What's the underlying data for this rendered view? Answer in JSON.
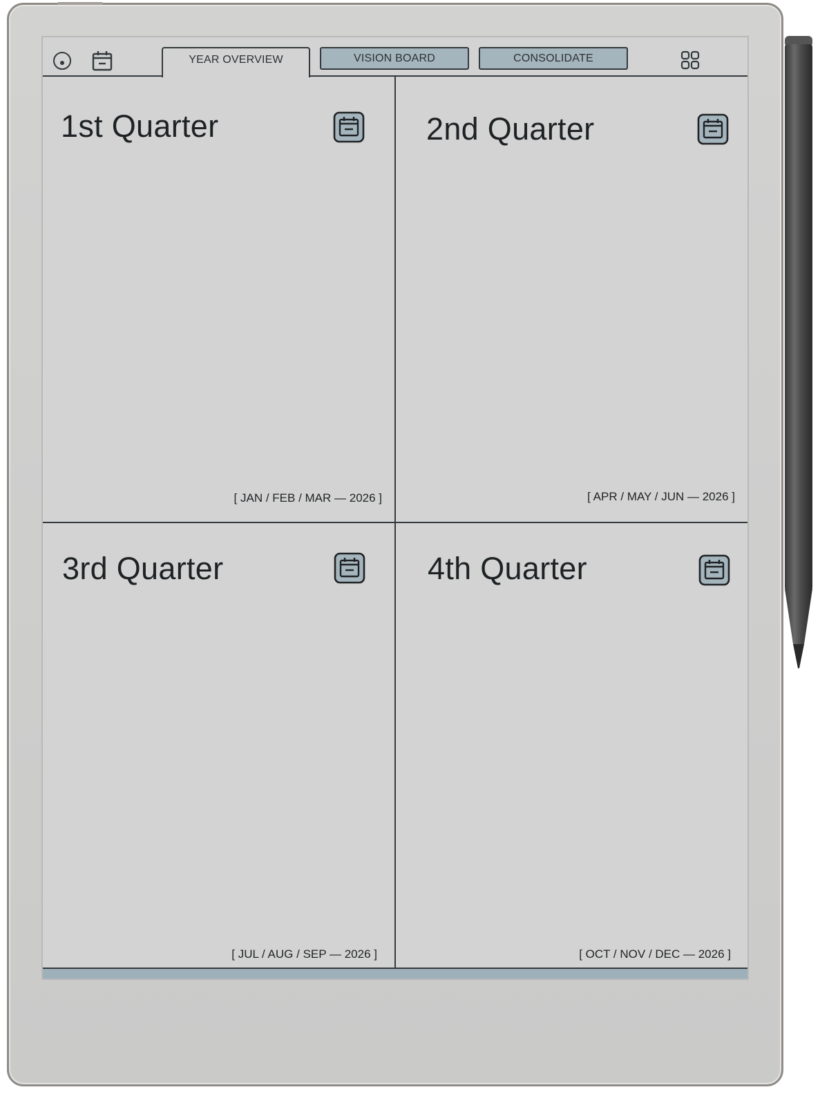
{
  "toolbar": {
    "icons": [
      "menu-circle-icon",
      "calendar-icon",
      "grid-apps-icon"
    ],
    "tabs": [
      {
        "label": "YEAR OVERVIEW",
        "active": true
      },
      {
        "label": "VISION BOARD",
        "active": false
      },
      {
        "label": "CONSOLIDATE",
        "active": false
      }
    ]
  },
  "quarters": [
    {
      "title": "1st Quarter",
      "range": "[ JAN / FEB / MAR — 2026 ]",
      "icon": "calendar-icon"
    },
    {
      "title": "2nd Quarter",
      "range": "[ APR / MAY / JUN — 2026 ]",
      "icon": "calendar-icon"
    },
    {
      "title": "3rd Quarter",
      "range": "[ JUL / AUG / SEP — 2026 ]",
      "icon": "calendar-icon"
    },
    {
      "title": "4th Quarter",
      "range": "[ OCT / NOV / DEC — 2026 ]",
      "icon": "calendar-icon"
    }
  ],
  "colors": {
    "screen": "#d3d3d3",
    "ink": "#33393c",
    "tab_inactive": "#a5b5bd",
    "accent_bar": "#9eb0ba"
  }
}
